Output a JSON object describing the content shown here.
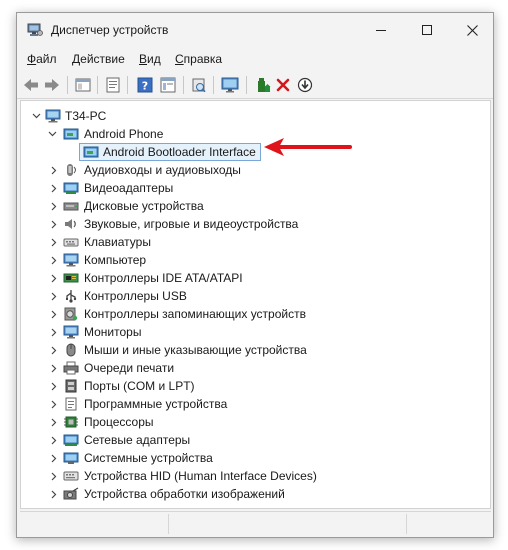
{
  "window": {
    "title": "Диспетчер устройств",
    "controls": {
      "minimize": "minimize",
      "maximize": "maximize",
      "close": "close"
    }
  },
  "menu": [
    {
      "label": "Файл",
      "accel": "Ф",
      "rest": "айл"
    },
    {
      "label": "Действие",
      "accel": "Д",
      "rest": "ействие"
    },
    {
      "label": "Вид",
      "accel": "В",
      "rest": "ид"
    },
    {
      "label": "Справка",
      "accel": "С",
      "rest": "правка"
    }
  ],
  "toolbar": {
    "buttons": [
      "back-icon",
      "forward-icon",
      "console-tree-icon",
      "properties-icon",
      "help-icon",
      "view-icon",
      "scan-hardware-icon",
      "monitor-icon",
      "update-driver-icon",
      "uninstall-icon",
      "disable-device-icon"
    ]
  },
  "tree": {
    "root": {
      "label": "T34-PC",
      "icon": "computer-icon"
    },
    "expanded_category": {
      "label": "Android Phone",
      "icon": "phone-device-icon"
    },
    "selected_device": {
      "label": "Android Bootloader Interface",
      "icon": "adb-device-icon"
    },
    "categories": [
      {
        "label": "Аудиовходы и аудиовыходы",
        "icon": "audio-io-icon"
      },
      {
        "label": "Видеоадаптеры",
        "icon": "display-adapter-icon"
      },
      {
        "label": "Дисковые устройства",
        "icon": "disk-drive-icon"
      },
      {
        "label": "Звуковые, игровые и видеоустройства",
        "icon": "sound-icon"
      },
      {
        "label": "Клавиатуры",
        "icon": "keyboard-icon"
      },
      {
        "label": "Компьютер",
        "icon": "computer-icon"
      },
      {
        "label": "Контроллеры IDE ATA/ATAPI",
        "icon": "ide-controller-icon"
      },
      {
        "label": "Контроллеры USB",
        "icon": "usb-icon"
      },
      {
        "label": "Контроллеры запоминающих устройств",
        "icon": "storage-controller-icon"
      },
      {
        "label": "Мониторы",
        "icon": "monitor-icon"
      },
      {
        "label": "Мыши и иные указывающие устройства",
        "icon": "mouse-icon"
      },
      {
        "label": "Очереди печати",
        "icon": "printer-icon"
      },
      {
        "label": "Порты (COM и LPT)",
        "icon": "port-icon"
      },
      {
        "label": "Программные устройства",
        "icon": "software-device-icon"
      },
      {
        "label": "Процессоры",
        "icon": "processor-icon"
      },
      {
        "label": "Сетевые адаптеры",
        "icon": "network-adapter-icon"
      },
      {
        "label": "Системные устройства",
        "icon": "system-device-icon"
      },
      {
        "label": "Устройства HID (Human Interface Devices)",
        "icon": "hid-icon"
      },
      {
        "label": "Устройства обработки изображений",
        "icon": "imaging-device-icon"
      }
    ]
  },
  "annotation": {
    "arrow_color": "#e0131b"
  },
  "colors": {
    "selection_bg": "#e5f1fb",
    "selection_border": "#7aa7d8"
  }
}
